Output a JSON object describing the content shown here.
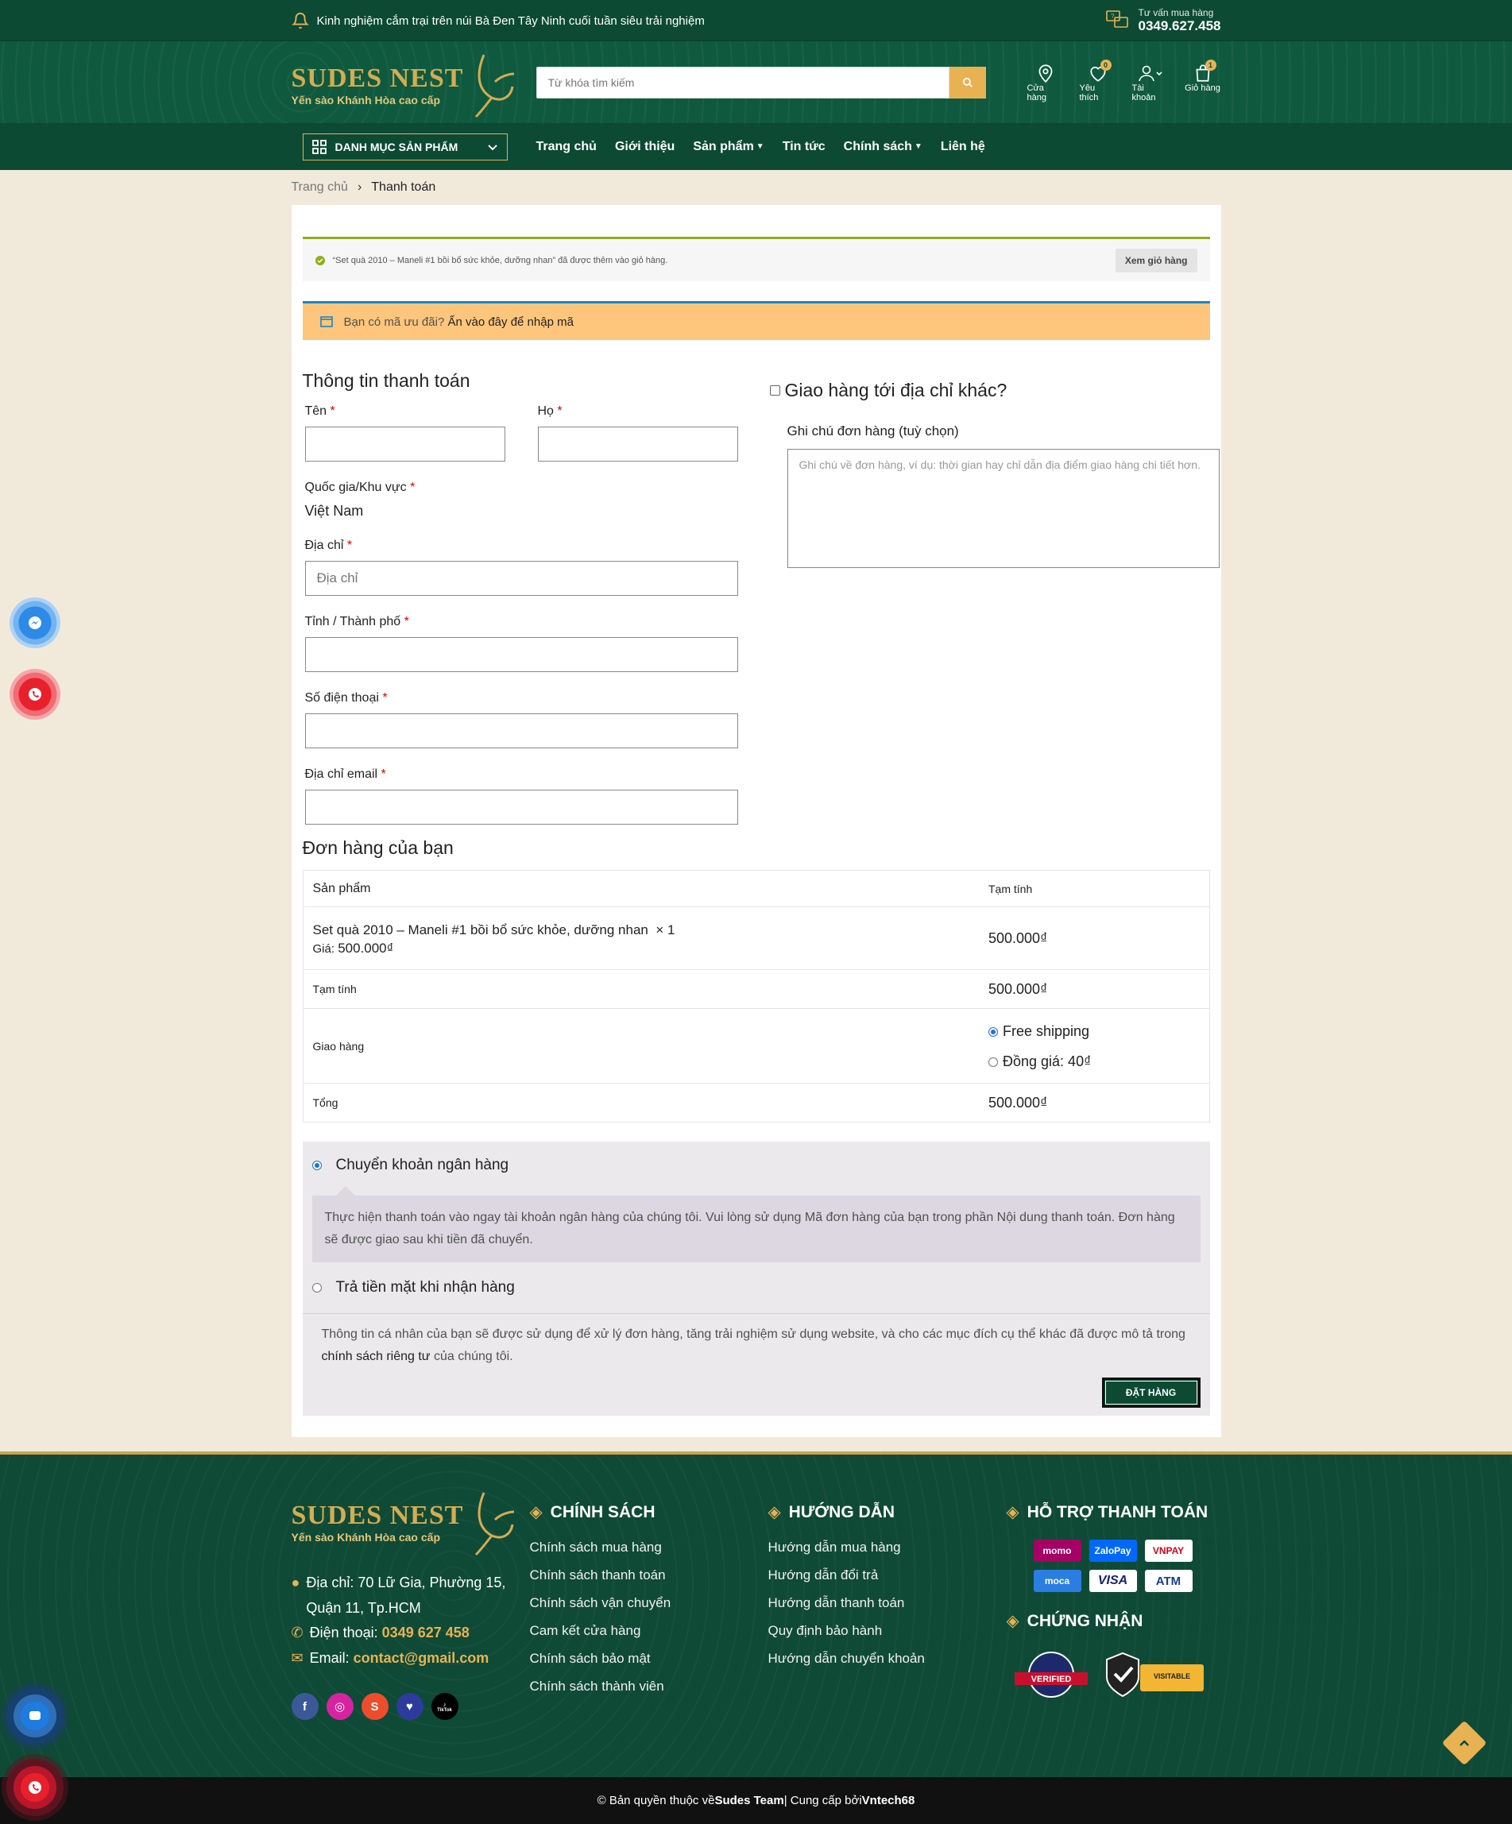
{
  "topbar": {
    "message": "Kinh nghiệm cắm trại trên núi Bà Đen Tây Ninh cuối tuần siêu trải nghiệm",
    "hotline_label": "Tư vấn mua hàng",
    "hotline_number": "0349.627.458"
  },
  "header": {
    "brand": "SUDES NEST",
    "tagline": "Yến sào Khánh Hòa cao cấp",
    "search_placeholder": "Từ khóa tìm kiếm",
    "icons": [
      {
        "label": "Cửa hàng",
        "icon": "map-pin-icon"
      },
      {
        "label": "Yêu thích",
        "icon": "heart-icon",
        "badge": "0"
      },
      {
        "label": "Tài khoản",
        "icon": "user-icon"
      },
      {
        "label": "Giỏ hàng",
        "icon": "cart-icon",
        "badge": "1"
      }
    ]
  },
  "nav": {
    "category_button": "DANH MỤC SẢN PHẨM",
    "items": [
      "Trang chủ",
      "Giới thiệu",
      "Sản phẩm",
      "Tin tức",
      "Chính sách",
      "Liên hệ"
    ]
  },
  "breadcrumb": {
    "home": "Trang chủ",
    "current": "Thanh toán"
  },
  "notice": {
    "text": "“Set quà 2010 – Maneli #1 bồi bổ sức khỏe, dưỡng nhan” đã được thêm vào giỏ hàng.",
    "button": "Xem giỏ hàng"
  },
  "coupon": {
    "prompt": "Bạn có mã ưu đãi?",
    "link": "Ấn vào đây để nhập mã"
  },
  "billing": {
    "title": "Thông tin thanh toán",
    "first_name": "Tên",
    "last_name": "Họ",
    "country_label": "Quốc gia/Khu vực",
    "country_value": "Việt Nam",
    "address_label": "Địa chỉ",
    "address_placeholder": "Địa chỉ",
    "city_label": "Tỉnh / Thành phố",
    "phone_label": "Số điện thoại",
    "email_label": "Địa chỉ email",
    "required_mark": "*"
  },
  "shipping": {
    "different_address": "Giao hàng tới địa chỉ khác?",
    "notes_label": "Ghi chú đơn hàng (tuỳ chọn)",
    "notes_placeholder": "Ghi chú về đơn hàng, ví dụ: thời gian hay chỉ dẫn địa điểm giao hàng chi tiết hơn."
  },
  "order": {
    "title": "Đơn hàng của bạn",
    "col_product": "Sản phẩm",
    "col_subtotal": "Tạm tính",
    "product_name": "Set quà 2010 – Maneli #1 bồi bổ sức khỏe, dưỡng nhan",
    "product_qty": "× 1",
    "price_label": "Giá:",
    "price_value": "500.000₫",
    "line_total": "500.000₫",
    "subtotal_label": "Tạm tính",
    "subtotal_value": "500.000₫",
    "shipping_label": "Giao hàng",
    "shipping_options": [
      "Free shipping",
      "Đồng giá: 40₫"
    ],
    "total_label": "Tổng",
    "total_value": "500.000₫"
  },
  "payment": {
    "bank_transfer": "Chuyển khoản ngân hàng",
    "bank_desc": "Thực hiện thanh toán vào ngay tài khoản ngân hàng của chúng tôi. Vui lòng sử dụng Mã đơn hàng của bạn trong phần Nội dung thanh toán. Đơn hàng sẽ được giao sau khi tiền đã chuyển.",
    "cod": "Trả tiền mặt khi nhận hàng",
    "privacy_1": "Thông tin cá nhân của bạn sẽ được sử dụng để xử lý đơn hàng, tăng trải nghiệm sử dụng website, và cho các mục đích cụ thể khác đã được mô tả trong ",
    "privacy_link": "chính sách riêng tư",
    "privacy_2": " của chúng tôi.",
    "place_order": "ĐẶT HÀNG"
  },
  "footer": {
    "brand": "SUDES NEST",
    "tagline": "Yến sào Khánh Hòa cao cấp",
    "address": "Địa chỉ: 70 Lữ Gia, Phường 15, Quận 11, Tp.HCM",
    "phone_label": "Điện thoại:",
    "phone": "0349 627 458",
    "email_label": "Email:",
    "email": "contact@gmail.com",
    "col_policy": {
      "title": "CHÍNH SÁCH",
      "items": [
        "Chính sách mua hàng",
        "Chính sách thanh toán",
        "Chính sách vận chuyển",
        "Cam kết cửa hàng",
        "Chính sách bảo mật",
        "Chính sách thành viên"
      ]
    },
    "col_guide": {
      "title": "HƯỚNG DẪN",
      "items": [
        "Hướng dẫn mua hàng",
        "Hướng dẫn đổi trả",
        "Hướng dẫn thanh toán",
        "Quy định bảo hành",
        "Hướng dẫn chuyển khoản"
      ]
    },
    "payment_title": "HỖ TRỢ THANH TOÁN",
    "payment_logos": [
      "momo",
      "ZaloPay",
      "VNPAY",
      "moca",
      "VISA",
      "ATM"
    ],
    "cert_title": "CHỨNG NHẬN",
    "cert_labels": [
      "VERIFIED",
      "VISITABLE"
    ],
    "social": [
      "f",
      "ig",
      "sh",
      "lz",
      "tt"
    ],
    "tiktok_label": "TikTok",
    "copyright_1": "© Bản quyền thuộc về ",
    "copyright_team": "Sudes Team",
    "copyright_2": " | Cung cấp bởi ",
    "copyright_by": "Vntech68"
  },
  "sidebar": {
    "messenger": "messenger-icon",
    "phone": "phone-icon",
    "zalo": "zalo-icon",
    "call": "call-icon"
  },
  "colors": {
    "primary": "#0c4a34",
    "accent": "#e8b253",
    "coupon_bg": "#fdc67c",
    "notice_border": "#8fae1b"
  }
}
